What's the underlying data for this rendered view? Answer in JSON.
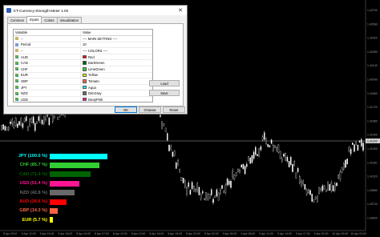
{
  "dialog": {
    "title": "KT-Currency-Strength-Meter 1.00",
    "tabs": [
      "Common",
      "Inputs",
      "Colors",
      "Visualization"
    ],
    "active_tab": "Inputs",
    "table": {
      "headers": [
        "Variable",
        "Value"
      ],
      "rows": [
        {
          "variable": "--",
          "value": "---- MAIN SETTING ----",
          "icon": "text-icon"
        },
        {
          "variable": "Period",
          "value": "10",
          "icon": "number-icon"
        },
        {
          "variable": "--",
          "value": "---- COLORS ----",
          "icon": "text-icon"
        },
        {
          "variable": "AUD",
          "value": "Red",
          "swatch": "#ff0000",
          "icon": "color-icon"
        },
        {
          "variable": "CAD",
          "value": "DarkGreen",
          "swatch": "#006400",
          "icon": "color-icon"
        },
        {
          "variable": "CHF",
          "value": "LimeGreen",
          "swatch": "#32cd32",
          "icon": "color-icon"
        },
        {
          "variable": "EUR",
          "value": "Yellow",
          "swatch": "#ffff00",
          "icon": "color-icon"
        },
        {
          "variable": "GBP",
          "value": "Tomato",
          "swatch": "#ff6347",
          "icon": "color-icon"
        },
        {
          "variable": "JPY",
          "value": "Aqua",
          "swatch": "#00ffff",
          "icon": "color-icon"
        },
        {
          "variable": "NZD",
          "value": "DimGray",
          "swatch": "#696969",
          "icon": "color-icon"
        },
        {
          "variable": "USD",
          "value": "DeepPink",
          "swatch": "#ff1493",
          "icon": "color-icon"
        }
      ]
    },
    "load_label": "Load",
    "save_label": "Save",
    "ok_label": "OK",
    "cancel_label": "Отмена",
    "reset_label": "Reset"
  },
  "meter": [
    {
      "label": "JPY (100.0 %)",
      "percent": 100.0,
      "color": "#00ffff"
    },
    {
      "label": "CHF (85.7 %)",
      "percent": 85.7,
      "color": "#32cd32"
    },
    {
      "label": "CAD (71.4 %)",
      "percent": 71.4,
      "color": "#006400"
    },
    {
      "label": "USD (51.4 %)",
      "percent": 51.4,
      "color": "#ff1493"
    },
    {
      "label": "NZD (42.8 %)",
      "percent": 42.8,
      "color": "#696969"
    },
    {
      "label": "AUD (28.6 %)",
      "percent": 28.6,
      "color": "#ff0000"
    },
    {
      "label": "GBP (14.3 %)",
      "percent": 14.3,
      "color": "#ff6347"
    },
    {
      "label": "EUR (5.7 %)",
      "percent": 5.7,
      "color": "#ffff00"
    }
  ],
  "chart": {
    "price_labels": [
      "1.42700",
      "1.42560",
      "1.42420",
      "1.42280",
      "1.42140",
      "1.42000",
      "1.41860",
      "1.41720",
      "1.41580",
      "1.41440",
      "1.41300",
      "1.41160",
      "1.41020",
      "1.40880",
      "1.40740",
      "1.40600"
    ],
    "current_price": "1.41200",
    "time_labels": [
      "5 Apr 2019",
      "5 Apr 12:00",
      "5 Apr 15:00",
      "5 Apr 18:00",
      "8 Apr 04:00",
      "8 Apr 07:00",
      "8 Apr 10:00",
      "8 Apr 13:00",
      "8 Apr 16:00",
      "8 Apr 19:00",
      "8 Apr 22:00",
      "9 Apr 02:00",
      "9 Apr 05:00",
      "9 Apr 08:00",
      "9 Apr 11:00",
      "9 Apr 14:00",
      "9 Apr 17:00",
      "9 Apr 20:00",
      "10 Apr 00:00",
      "10 Apr 03:00"
    ]
  },
  "colors": {
    "background": "#000000",
    "candle": "#ffffff",
    "grid": "#2a2a2a",
    "price_line": "#cfcfcf"
  }
}
